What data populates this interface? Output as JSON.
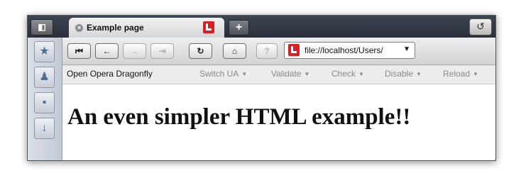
{
  "tab": {
    "title": "Example page"
  },
  "tabbar": {
    "panel_icon": "panel-toggle-icon",
    "new_tab_label": "+",
    "trash_icon": "closed-tabs-trash-icon"
  },
  "sidebar": {
    "items": [
      "bookmarks-icon",
      "contacts-icon",
      "notes-icon",
      "downloads-icon"
    ]
  },
  "toolbar": {
    "address": "file://localhost/Users/",
    "buttons": [
      "rewind-icon",
      "back-icon",
      "forward-icon",
      "fast-forward-icon",
      "reload-icon",
      "home-icon",
      "security-icon"
    ]
  },
  "devbar": {
    "dragonfly_label": "Open Opera Dragonfly",
    "menus": [
      "Switch UA",
      "Validate",
      "Check",
      "Disable",
      "Reload"
    ]
  },
  "page": {
    "heading": "An even simpler HTML example!!"
  },
  "colors": {
    "opera_red": "#d81f26",
    "tabbar_dark": "#2a2f3a",
    "sidebar": "#c4cad4"
  }
}
